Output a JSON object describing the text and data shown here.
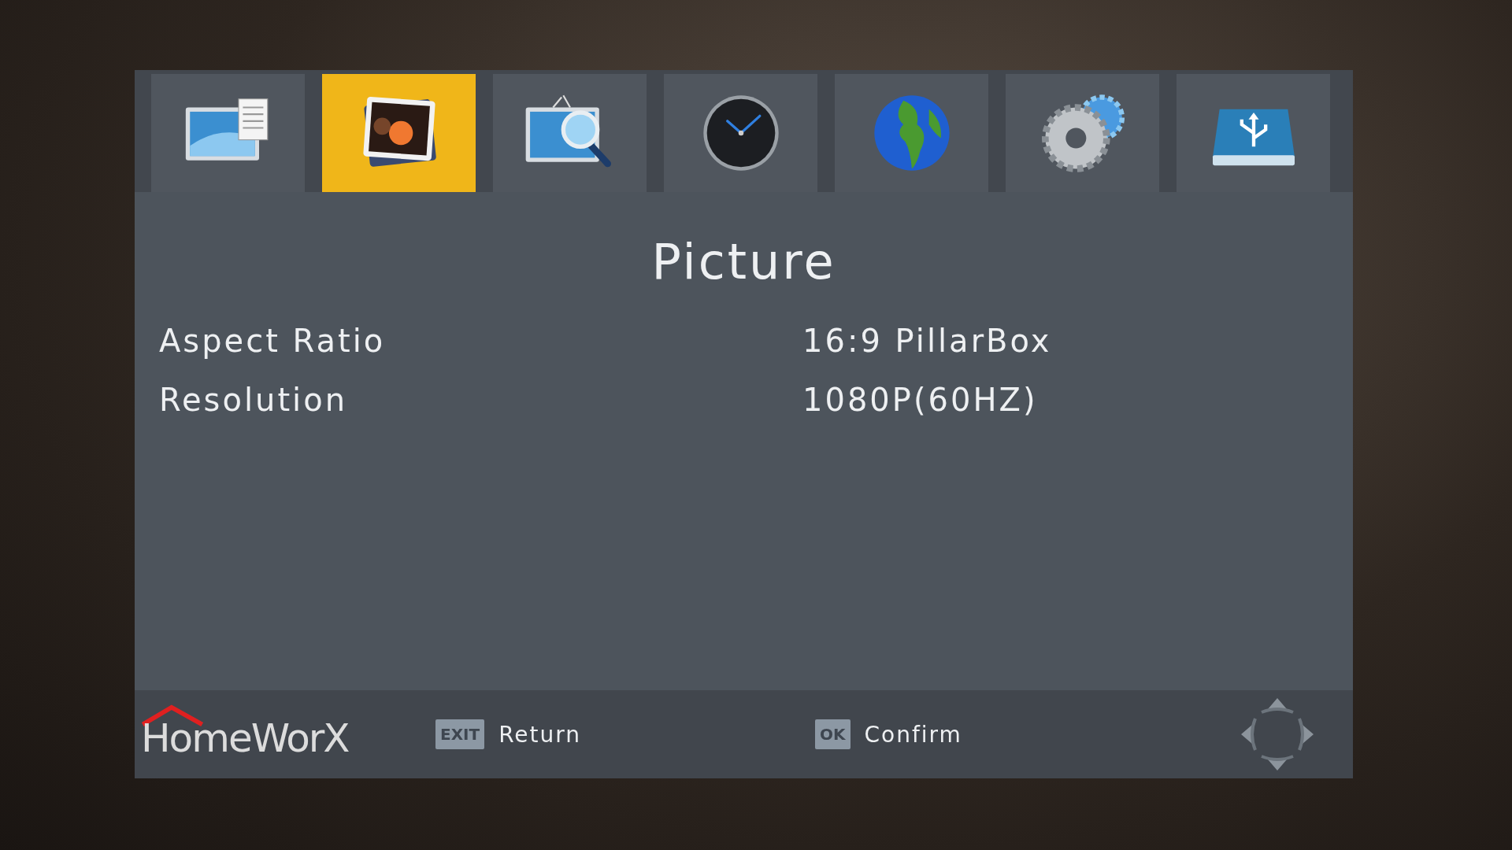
{
  "tabs": [
    {
      "kind": "display",
      "selected": false
    },
    {
      "kind": "photo",
      "selected": true
    },
    {
      "kind": "tv-search",
      "selected": false
    },
    {
      "kind": "clock",
      "selected": false
    },
    {
      "kind": "globe",
      "selected": false
    },
    {
      "kind": "gears",
      "selected": false
    },
    {
      "kind": "usb",
      "selected": false
    }
  ],
  "page": {
    "title": "Picture"
  },
  "settings": [
    {
      "label": "Aspect Ratio",
      "value": "16:9 PillarBox"
    },
    {
      "label": "Resolution",
      "value": "1080P(60HZ)"
    }
  ],
  "footer": {
    "logo": "HomeWorX",
    "hints": [
      {
        "key": "EXIT",
        "label": "Return"
      },
      {
        "key": "OK",
        "label": "Confirm"
      }
    ]
  }
}
